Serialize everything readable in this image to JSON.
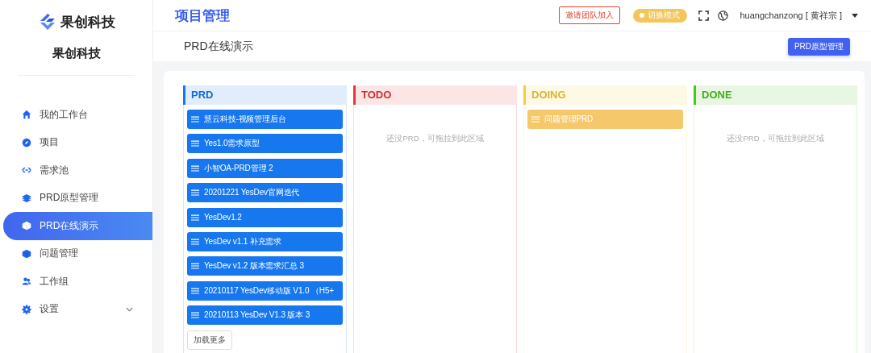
{
  "sidebar": {
    "logo_text": "果创科技",
    "org_name": "果创科技",
    "items": [
      {
        "label": "我的工作台",
        "selected": false,
        "expandable": false
      },
      {
        "label": "项目",
        "selected": false,
        "expandable": false
      },
      {
        "label": "需求池",
        "selected": false,
        "expandable": false
      },
      {
        "label": "PRD原型管理",
        "selected": false,
        "expandable": false
      },
      {
        "label": "PRD在线演示",
        "selected": true,
        "expandable": false
      },
      {
        "label": "问题管理",
        "selected": false,
        "expandable": false
      },
      {
        "label": "工作组",
        "selected": false,
        "expandable": false
      },
      {
        "label": "设置",
        "selected": false,
        "expandable": true
      }
    ]
  },
  "header": {
    "title": "项目管理",
    "invite_button": "邀请团队加入",
    "mode_toggle": "切换模式",
    "user": "huangchanzong [ 黄祥宗 ]"
  },
  "subheader": {
    "title": "PRD在线演示",
    "button": "PRD原型管理"
  },
  "board": {
    "columns": [
      {
        "title": "PRD",
        "color": "#1677ee",
        "items": [
          "慧云科技-视频管理后台",
          "Yes1.0需求原型",
          "小智OA-PRD管理 2",
          "20201221 YesDev官网迭代",
          "YesDev1.2",
          "YesDev v1.1 补充需求",
          "YesDev v1.2 版本需求汇总 3",
          "20210117 YesDev移动版 V1.0 （H5+",
          "20210113 YesDev V1.3 版本 3"
        ],
        "load_more": "加载更多"
      },
      {
        "title": "TODO",
        "color": "#e8343a",
        "empty_text": "还没PRD，可拖拉到此区域"
      },
      {
        "title": "DOING",
        "color": "#f2cf3a",
        "items": [
          "问题管理PRD"
        ]
      },
      {
        "title": "DONE",
        "color": "#4cc51f",
        "empty_text": "还没PRD，可拖拉到此区域"
      }
    ]
  }
}
